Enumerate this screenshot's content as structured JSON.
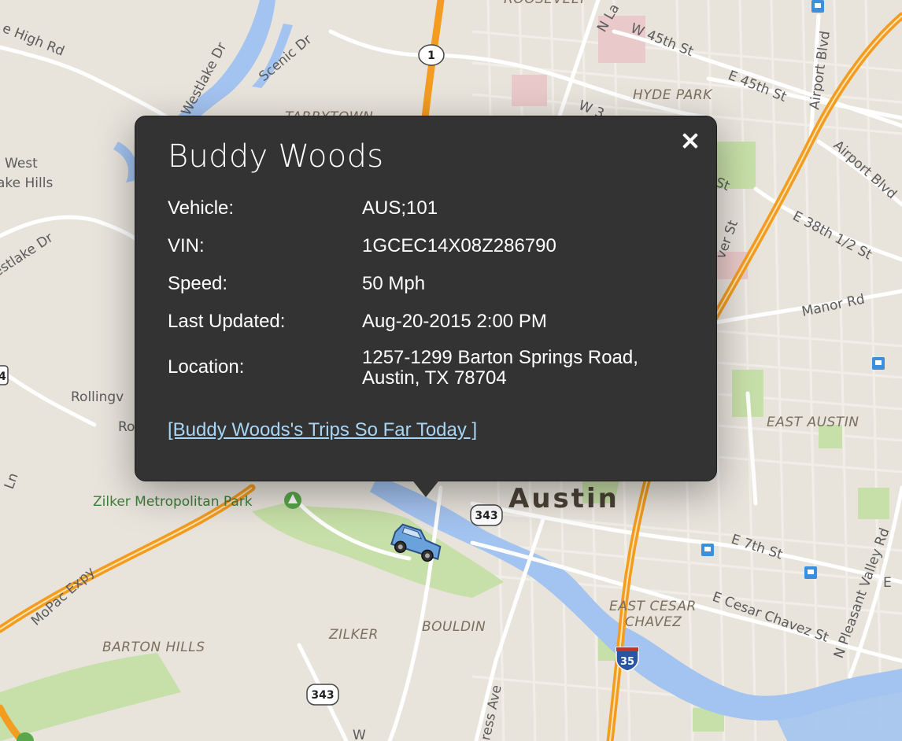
{
  "map": {
    "place_labels": {
      "west_lake_hills_1": "West",
      "west_lake_hills_2": "ake Hills",
      "rollingwood": "Rollingv",
      "ro": "Ro",
      "ln": "Ln",
      "tarrytown": "TARRYTOWN",
      "hyde_park": "HYDE PARK",
      "east_austin": "EAST AUSTIN",
      "east_cesar_chavez_1": "EAST CESAR",
      "east_cesar_chavez_2": "CHAVEZ",
      "zilker": "ZILKER",
      "bouldin": "BOULDIN",
      "barton_hills": "BARTON HILLS",
      "austin": "Austin",
      "roosevelt": "ROOSEVELT",
      "zilker_park": "Zilker Metropolitan Park"
    },
    "road_labels": {
      "high_rd": "e High Rd",
      "westlake_dr_top": "Westlake Dr",
      "scenic_dr": "Scenic Dr",
      "westlake_dr_left": "estlake Dr",
      "n_lamar": "N La",
      "w_45th": "W 45th St",
      "e_45th": "E 45th St",
      "w_38": "W 3",
      "airport_blvd_v": "Airport Blvd",
      "airport_blvd_d": "Airport Blvd",
      "e_38th_half": "E 38th 1/2 St",
      "st_frag": "St",
      "duval_frag": "ver St",
      "manor_rd": "Manor Rd",
      "e_7th": "E 7th St",
      "e_cesar_chavez": "E Cesar Chavez St",
      "n_pleasant_valley": "N Pleasant Valley Rd",
      "mopac": "MoPac Expy",
      "congress": "ress Ave",
      "w_frag": "W",
      "e_frag": "E"
    },
    "shields": {
      "loop1": "1",
      "hwy343_a": "343",
      "hwy343_b": "343",
      "i35": "35",
      "left_edge": "4"
    },
    "colors": {
      "water": "#a3c3f0",
      "park": "#c7dfa8",
      "highway": "#f39c1f",
      "arterial": "#ffffff",
      "background": "#e8e4dc"
    },
    "icons": [
      "car-marker-icon",
      "bus-stop-icon",
      "park-tree-icon"
    ]
  },
  "popup": {
    "title": "Buddy Woods",
    "rows": [
      {
        "label": "Vehicle:",
        "value": "AUS;101"
      },
      {
        "label": "VIN:",
        "value": "1GCEC14X08Z286790"
      },
      {
        "label": "Speed:",
        "value": "50 Mph"
      },
      {
        "label": "Last Updated:",
        "value": "Aug-20-2015 2:00 PM"
      },
      {
        "label": "Location:",
        "value_line1": "1257-1299 Barton Springs Road,",
        "value_line2": "Austin, TX 78704"
      }
    ],
    "link": "[Buddy Woods's Trips So Far Today ]",
    "colors": {
      "background": "#333333",
      "text": "#ffffff",
      "link": "#a9d6f5"
    }
  }
}
